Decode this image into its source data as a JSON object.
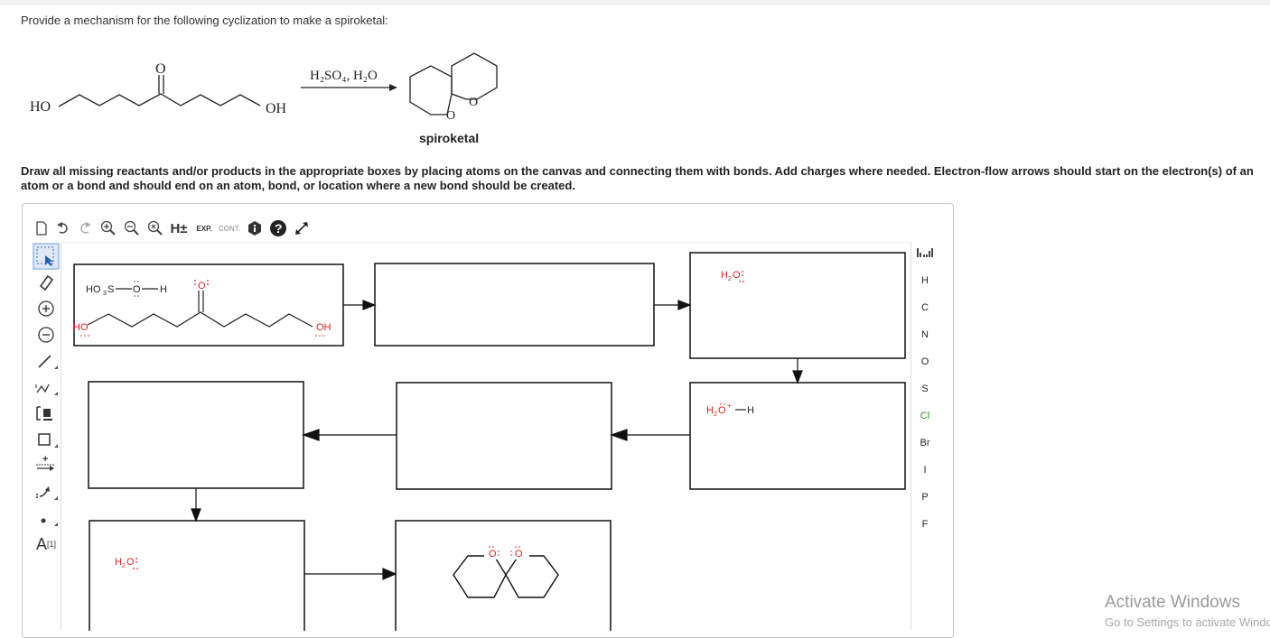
{
  "question": "Provide a mechanism for the following cyclization to make a spiroketal:",
  "reaction": {
    "reactant_left_group": "HO",
    "reactant_right_group": "OH",
    "carbonyl_atom": "O",
    "reagents": "H₂SO₄, H₂O",
    "product_atom_top": "O",
    "product_atom_bottom": "O",
    "product_label": "spiroketal"
  },
  "instructions": "Draw all missing reactants and/or products in the appropriate boxes by placing atoms on the canvas and connecting them with bonds. Add charges where needed. Electron-flow arrows should start on the electron(s) of an atom or a bond and should end on an atom, bond, or location where a new bond should be created.",
  "toolbar": {
    "h_plusminus": "H±",
    "exp": "EXP.",
    "cont": "CONT."
  },
  "left_tools": {
    "charge_label": "A",
    "charge_sup": "[1]"
  },
  "elements": [
    "H",
    "C",
    "N",
    "O",
    "S",
    "Cl",
    "Br",
    "I",
    "P",
    "F"
  ],
  "boxes": {
    "box1_acid": "HO",
    "box1_acid_sub": "3",
    "box1_acid_s": "S",
    "box1_acid_o": "O",
    "box1_acid_h": "H",
    "box1_carbonyl_o": "O",
    "box1_ho": "HO",
    "box1_oh": "OH",
    "box3_water": "H",
    "box3_water_sub": "2",
    "box3_water_o": "O",
    "box4_hydronium": "H",
    "box4_hydronium_sub": "2",
    "box4_hydronium_o": "O",
    "box4_hydronium_plus": "+",
    "box4_hydronium_h": "H",
    "box7_water": "H",
    "box7_water_sub": "2",
    "box7_water_o": "O",
    "box8_o1": "O",
    "box8_o2": "O"
  },
  "watermark": {
    "title": "Activate Windows",
    "subtitle": "Go to Settings to activate Windows."
  }
}
